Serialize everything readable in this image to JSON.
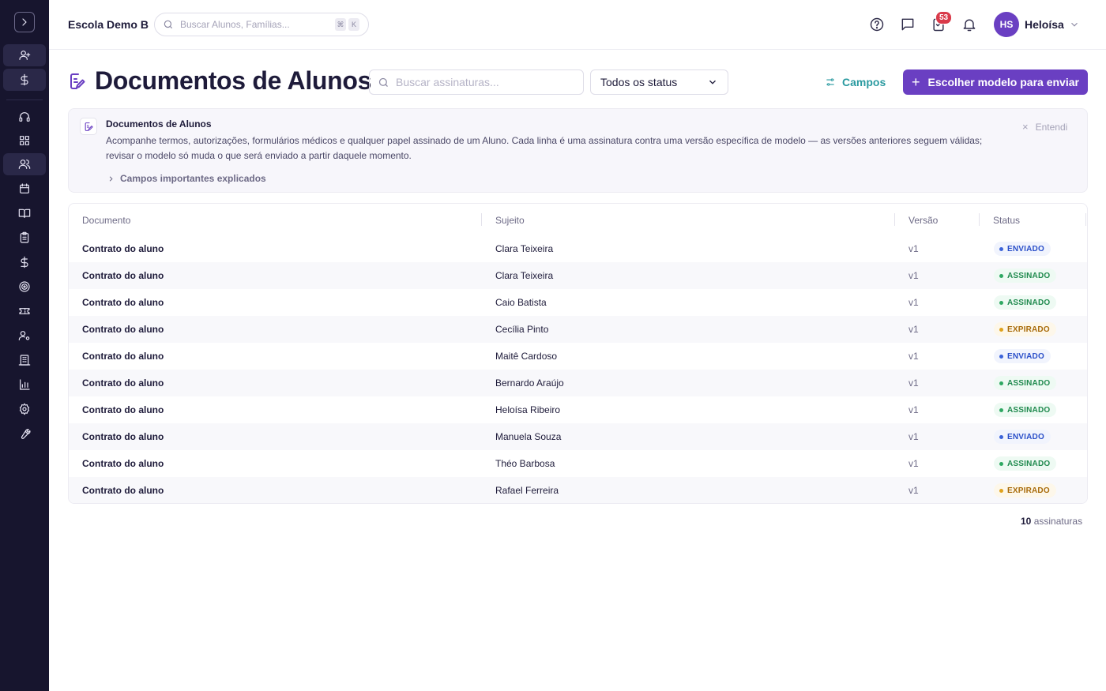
{
  "header": {
    "school": "Escola Demo B",
    "search_placeholder": "Buscar Alunos, Famílias...",
    "kbd": [
      "⌘",
      "K"
    ],
    "notification_count": "53",
    "user_initials": "HS",
    "user_name": "Heloísa"
  },
  "page": {
    "title": "Documentos de Alunos",
    "search_placeholder": "Buscar assinaturas...",
    "status_filter": "Todos os status",
    "fields_button": "Campos",
    "primary_button": "Escolher modelo para enviar"
  },
  "banner": {
    "title": "Documentos de Alunos",
    "text": "Acompanhe termos, autorizações, formulários médicos e qualquer papel assinado de um Aluno. Cada linha é uma assinatura contra uma versão específica de modelo — as versões anteriores seguem válidas; revisar o modelo só muda o que será enviado a partir daquele momento.",
    "more": "Campos importantes explicados",
    "dismiss": "Entendi"
  },
  "table": {
    "columns": [
      "Documento",
      "Sujeito",
      "Versão",
      "Status"
    ],
    "rows": [
      {
        "doc": "Contrato do aluno",
        "subject": "Clara Teixeira",
        "version": "v1",
        "status": "ENVIADO"
      },
      {
        "doc": "Contrato do aluno",
        "subject": "Clara Teixeira",
        "version": "v1",
        "status": "ASSINADO"
      },
      {
        "doc": "Contrato do aluno",
        "subject": "Caio Batista",
        "version": "v1",
        "status": "ASSINADO"
      },
      {
        "doc": "Contrato do aluno",
        "subject": "Cecília Pinto",
        "version": "v1",
        "status": "EXPIRADO"
      },
      {
        "doc": "Contrato do aluno",
        "subject": "Maitê Cardoso",
        "version": "v1",
        "status": "ENVIADO"
      },
      {
        "doc": "Contrato do aluno",
        "subject": "Bernardo Araújo",
        "version": "v1",
        "status": "ASSINADO"
      },
      {
        "doc": "Contrato do aluno",
        "subject": "Heloísa Ribeiro",
        "version": "v1",
        "status": "ASSINADO"
      },
      {
        "doc": "Contrato do aluno",
        "subject": "Manuela Souza",
        "version": "v1",
        "status": "ENVIADO"
      },
      {
        "doc": "Contrato do aluno",
        "subject": "Théo Barbosa",
        "version": "v1",
        "status": "ASSINADO"
      },
      {
        "doc": "Contrato do aluno",
        "subject": "Rafael Ferreira",
        "version": "v1",
        "status": "EXPIRADO"
      }
    ]
  },
  "footer": {
    "count": "10",
    "count_label": "assinaturas"
  },
  "colors": {
    "accent": "#6a3fc2",
    "sidebar": "#17152e",
    "teal": "#2a9aa0"
  },
  "sidebar": {
    "icons": [
      "user-plus-icon",
      "dollar-icon",
      "headset-icon",
      "dashboard-icon",
      "users-icon",
      "calendar-icon",
      "book-icon",
      "clipboard-icon",
      "dollar-icon",
      "target-icon",
      "ticket-icon",
      "user-gear-icon",
      "building-icon",
      "bar-chart-icon",
      "gear-icon",
      "wrench-icon"
    ]
  }
}
